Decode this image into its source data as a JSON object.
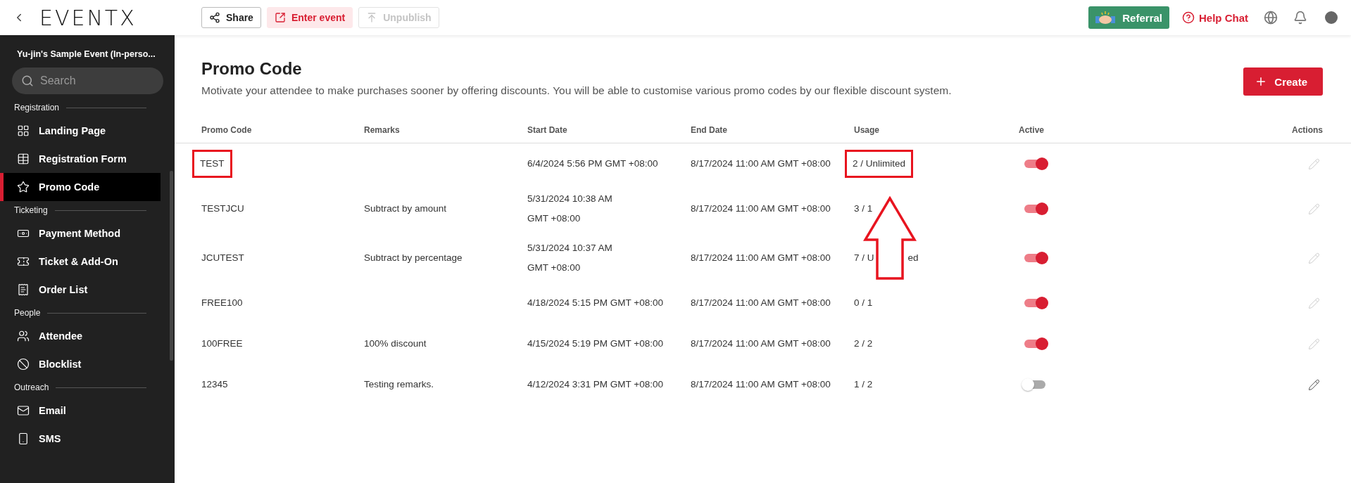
{
  "topbar": {
    "logo": "EVENTX",
    "actions": [
      {
        "label": "Share",
        "kind": "outline"
      },
      {
        "label": "Enter event",
        "kind": "tinted"
      },
      {
        "label": "Unpublish",
        "kind": "disabled"
      }
    ],
    "referral": "Referral",
    "help": "Help Chat"
  },
  "sidebar": {
    "event_title": "Yu-jin's Sample Event (In-perso...",
    "search": {
      "placeholder": "Search"
    },
    "sections": [
      {
        "label": "Registration",
        "items": [
          {
            "label": "Landing Page",
            "selected": false
          },
          {
            "label": "Registration Form",
            "selected": false
          },
          {
            "label": "Promo Code",
            "selected": true
          }
        ]
      },
      {
        "label": "Ticketing",
        "items": [
          {
            "label": "Payment Method",
            "selected": false
          },
          {
            "label": "Ticket & Add-On",
            "selected": false
          },
          {
            "label": "Order List",
            "selected": false
          }
        ]
      },
      {
        "label": "People",
        "items": [
          {
            "label": "Attendee",
            "selected": false
          },
          {
            "label": "Blocklist",
            "selected": false
          }
        ]
      },
      {
        "label": "Outreach",
        "items": [
          {
            "label": "Email",
            "selected": false
          },
          {
            "label": "SMS",
            "selected": false
          }
        ]
      }
    ]
  },
  "page": {
    "title": "Promo Code",
    "description": "Motivate your attendee to make purchases sooner by offering discounts. You will be able to customise various promo codes by our flexible discount system.",
    "create_button": "Create"
  },
  "table": {
    "columns": [
      "Promo Code",
      "Remarks",
      "Start Date",
      "End Date",
      "Usage",
      "Active",
      "Actions"
    ],
    "rows": [
      {
        "code": "TEST",
        "code_highlighted": true,
        "remarks": "",
        "start": [
          "6/4/2024 5:56 PM GMT +08:00"
        ],
        "end": "8/17/2024 11:00 AM GMT +08:00",
        "usage": [
          "2 / Unlimited"
        ],
        "usage_highlighted": true,
        "active": true,
        "edit_disabled": true
      },
      {
        "code": "TESTJCU",
        "code_highlighted": false,
        "remarks": "Subtract by amount",
        "start": [
          "5/31/2024 10:38 AM",
          "GMT +08:00"
        ],
        "end": "8/17/2024 11:00 AM GMT +08:00",
        "usage": [
          "3 / 1"
        ],
        "usage_highlighted": false,
        "active": true,
        "edit_disabled": true
      },
      {
        "code": "JCUTEST",
        "code_highlighted": false,
        "remarks": "Subtract by percentage",
        "start": [
          "5/31/2024 10:37 AM",
          "GMT +08:00"
        ],
        "end": "8/17/2024 11:00 AM GMT +08:00",
        "usage": [
          "7 / U",
          "ed"
        ],
        "usage_highlighted": false,
        "active": true,
        "edit_disabled": true
      },
      {
        "code": "FREE100",
        "code_highlighted": false,
        "remarks": "",
        "start": [
          "4/18/2024 5:15 PM GMT +08:00"
        ],
        "end": "8/17/2024 11:00 AM GMT +08:00",
        "usage": [
          "0 / 1"
        ],
        "usage_highlighted": false,
        "active": true,
        "edit_disabled": true
      },
      {
        "code": "100FREE",
        "code_highlighted": false,
        "remarks": "100% discount",
        "start": [
          "4/15/2024 5:19 PM GMT +08:00"
        ],
        "end": "8/17/2024 11:00 AM GMT +08:00",
        "usage": [
          "2 / 2"
        ],
        "usage_highlighted": false,
        "active": true,
        "edit_disabled": true
      },
      {
        "code": "12345",
        "code_highlighted": false,
        "remarks": "Testing remarks.",
        "start": [
          "4/12/2024 3:31 PM GMT +08:00"
        ],
        "end": "8/17/2024 11:00 AM GMT +08:00",
        "usage": [
          "1 / 2"
        ],
        "usage_highlighted": false,
        "active": false,
        "edit_disabled": false
      }
    ]
  },
  "annotation": {
    "kind": "arrow-up"
  }
}
